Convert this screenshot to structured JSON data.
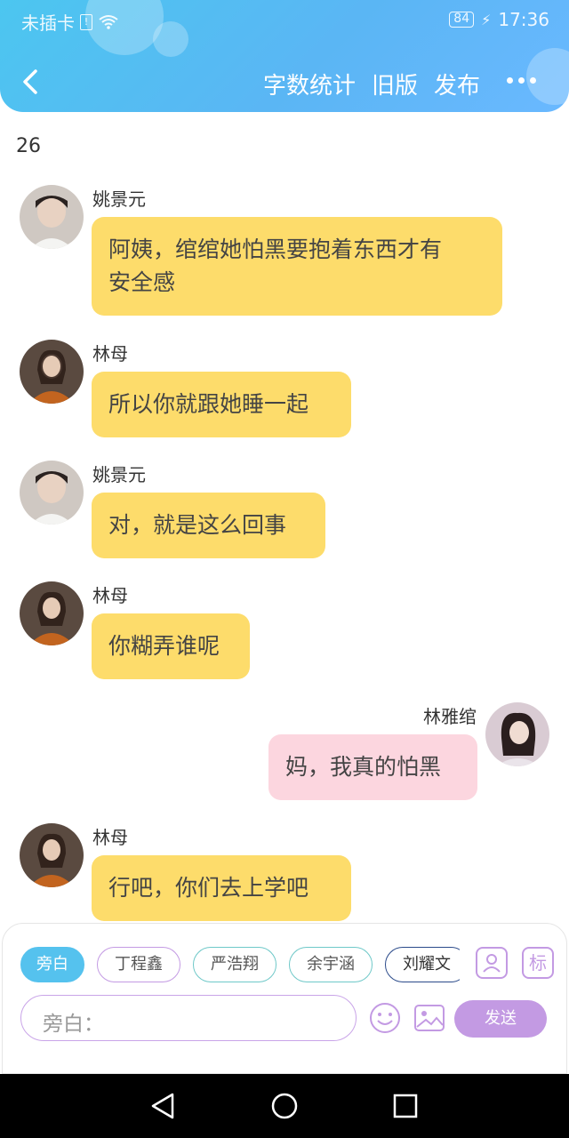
{
  "status": {
    "carrier": "未插卡",
    "battery": "84",
    "time": "17:36"
  },
  "nav": {
    "word_count": "字数统计",
    "old_version": "旧版",
    "publish": "发布"
  },
  "count": "26",
  "messages": [
    {
      "speaker": "姚景元",
      "text_lines": [
        "阿姨，绾绾她怕黑要抱着东西才有",
        "安全感"
      ],
      "side": "left",
      "color": "yellow"
    },
    {
      "speaker": "林母",
      "text_lines": [
        "所以你就跟她睡一起"
      ],
      "side": "left",
      "color": "yellow"
    },
    {
      "speaker": "姚景元",
      "text_lines": [
        "对，就是这么回事"
      ],
      "side": "left",
      "color": "yellow"
    },
    {
      "speaker": "林母",
      "text_lines": [
        "你糊弄谁呢"
      ],
      "side": "left",
      "color": "yellow"
    },
    {
      "speaker": "林雅绾",
      "text_lines": [
        "妈，我真的怕黑"
      ],
      "side": "right",
      "color": "pink"
    },
    {
      "speaker": "林母",
      "text_lines": [
        "行吧，你们去上学吧"
      ],
      "side": "left",
      "color": "yellow"
    }
  ],
  "chips": [
    "旁白",
    "丁程鑫",
    "严浩翔",
    "余宇涵",
    "刘耀文"
  ],
  "tools": {
    "tag_label": "标"
  },
  "input": {
    "placeholder": "旁白："
  },
  "send_label": "发送",
  "colors": {
    "header": "#55bff2",
    "yellow_bubble": "#fddc6b",
    "pink_bubble": "#fcd6df",
    "accent_purple": "#c39ae3",
    "chip_blue": "#55c2ee"
  }
}
